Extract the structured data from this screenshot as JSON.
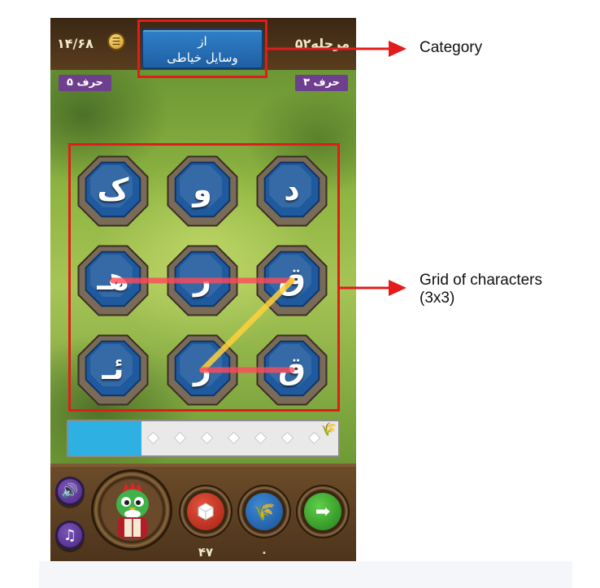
{
  "hud": {
    "score": "۱۴/۶۸",
    "level": "مرحله۵۲",
    "menu_icon": "list-icon",
    "category_line1": "از",
    "category_line2": "وسایل خیاطی",
    "badge_left": "۵ حرف",
    "badge_right": "۳ حرف"
  },
  "grid": {
    "rows": 3,
    "cols": 3,
    "tiles": [
      {
        "letter": "ک"
      },
      {
        "letter": "و"
      },
      {
        "letter": "د"
      },
      {
        "letter": "هـ"
      },
      {
        "letter": "ر"
      },
      {
        "letter": "ق"
      },
      {
        "letter": "ئـ"
      },
      {
        "letter": "ر"
      },
      {
        "letter": "ق"
      }
    ],
    "colors": {
      "tile_face": "#1f5a9e",
      "tile_rim": "#7a6a58",
      "path_red": "#ff4a5a",
      "path_yellow": "#ffd23a"
    }
  },
  "progress": {
    "fraction": 0.27,
    "wheat_icon": "wheat-icon"
  },
  "bottom": {
    "sound_icon": "speaker-icon",
    "music_icon": "music-note-icon",
    "avatar_icon": "rooster-character-icon",
    "reveal_icon": "cube-icon",
    "wheat_icon": "wheat-icon",
    "next_icon": "arrow-right-icon",
    "reveal_count": "۴۷",
    "wheat_count": "۰"
  },
  "annotations": {
    "category_label": "Category",
    "grid_label_line1": "Grid of characters",
    "grid_label_line2": "(3x3)"
  }
}
